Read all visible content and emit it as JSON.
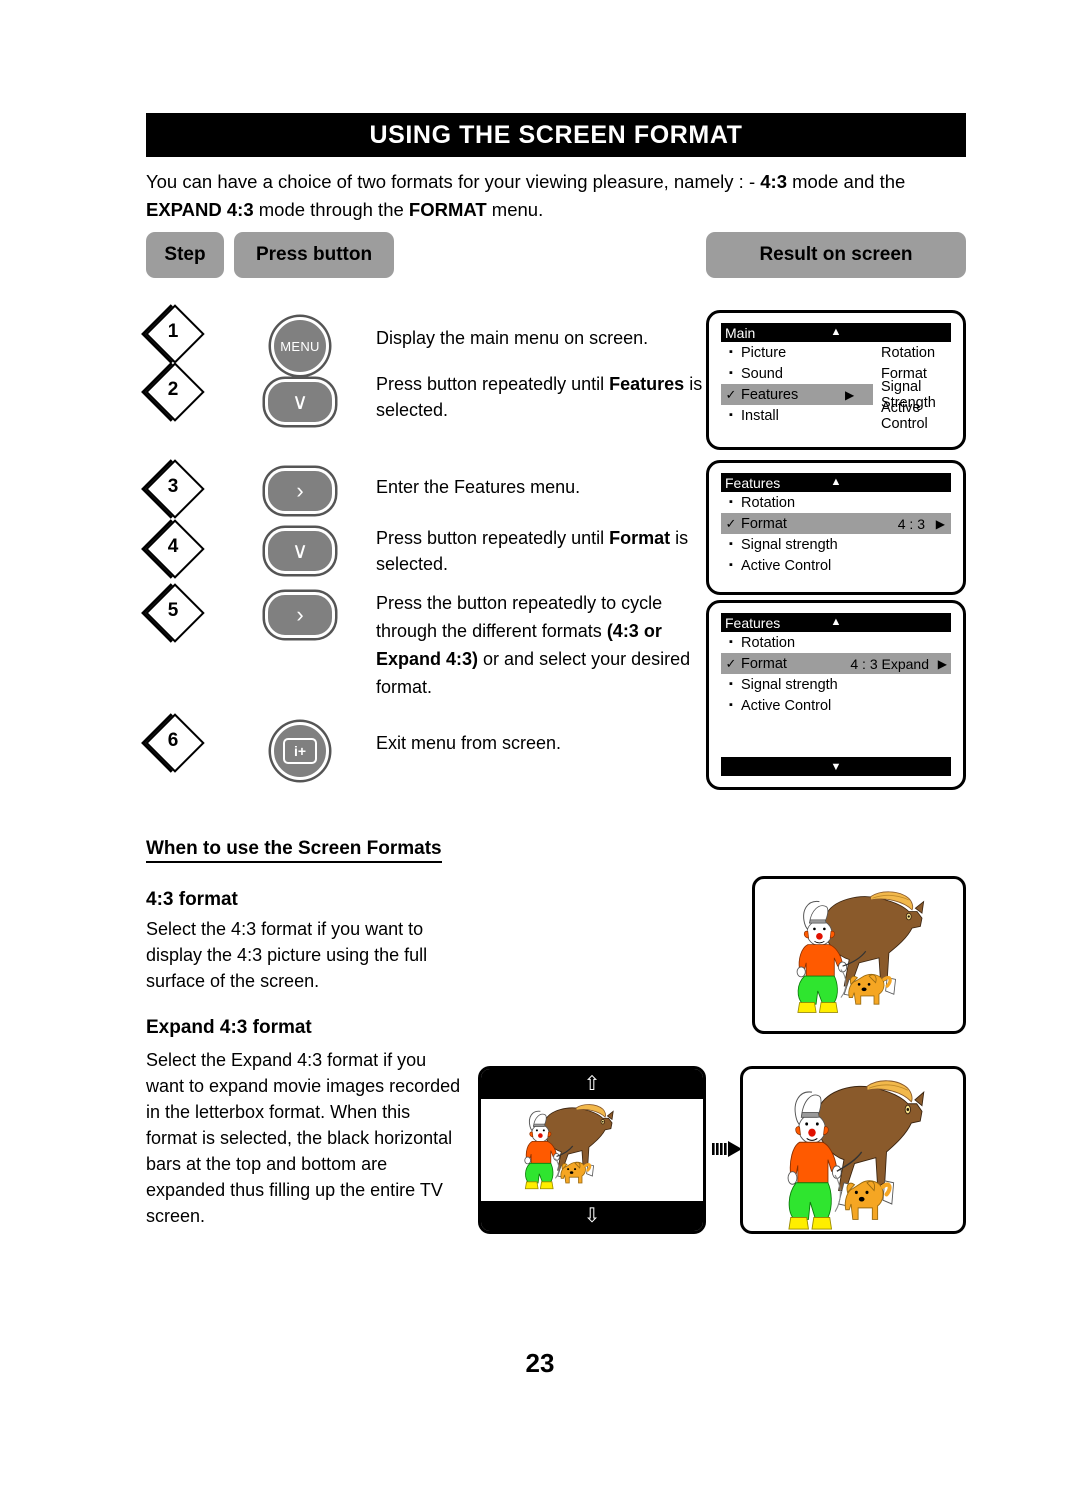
{
  "page": {
    "number": "23"
  },
  "header": {
    "title": "USING THE SCREEN FORMAT"
  },
  "intro": {
    "line1_a": "You can have a choice of two formats for your viewing pleasure, namely : - ",
    "line1_b": "4:3",
    "line1_c": " mode and the ",
    "line2_a": "EXPAND 4:3",
    "line2_b": " mode through the ",
    "line2_c": "FORMAT",
    "line2_d": " menu."
  },
  "columns": {
    "step": "Step",
    "press_button": "Press button",
    "result_on_screen": "Result on screen"
  },
  "steps": [
    {
      "number": "1",
      "button": {
        "type": "circle",
        "icon": "menu-button",
        "label": "MENU"
      },
      "text_1": "Display the main menu on screen.",
      "text_bold": "",
      "text_2": ""
    },
    {
      "number": "2",
      "button": {
        "type": "pill",
        "icon": "chevron-down-button",
        "label": "∨"
      },
      "text_1": "Press button repeatedly until ",
      "text_bold": "Features",
      "text_2": " is selected."
    },
    {
      "number": "3",
      "button": {
        "type": "pill",
        "icon": "chevron-right-button",
        "label": "›"
      },
      "text_1": "Enter the Features menu.",
      "text_bold": "",
      "text_2": ""
    },
    {
      "number": "4",
      "button": {
        "type": "pill",
        "icon": "chevron-down-button",
        "label": "∨"
      },
      "text_1": "Press button repeatedly until ",
      "text_bold": "Format",
      "text_2": " is selected."
    },
    {
      "number": "5",
      "button": {
        "type": "pill",
        "icon": "chevron-right-button",
        "label": "›"
      },
      "text_1": "Press the button repeatedly to cycle through the different formats ",
      "text_bold": "(4:3 or Expand 4:3)",
      "text_2": " or and select your desired format."
    },
    {
      "number": "6",
      "button": {
        "type": "circle",
        "icon": "info-plus-button",
        "label": "i+"
      },
      "text_1": "Exit menu from screen.",
      "text_bold": "",
      "text_2": ""
    }
  ],
  "screens": [
    {
      "name": "main-menu",
      "title": "Main",
      "up_caret": "▲",
      "rows": [
        {
          "marker": "▪",
          "label": "Picture",
          "selected": false,
          "col2": "Rotation",
          "value": "",
          "arrow": ""
        },
        {
          "marker": "▪",
          "label": "Sound",
          "selected": false,
          "col2": "Format",
          "value": "",
          "arrow": ""
        },
        {
          "marker": "✓",
          "label": "Features",
          "selected": true,
          "col2": "Signal Strength",
          "value": "",
          "arrow": "▶"
        },
        {
          "marker": "▪",
          "label": "Install",
          "selected": false,
          "col2": "Active Control",
          "value": "",
          "arrow": ""
        }
      ],
      "bottom_bar": false,
      "bottom_caret": ""
    },
    {
      "name": "features-menu-43",
      "title": "Features",
      "up_caret": "▲",
      "rows": [
        {
          "marker": "▪",
          "label": "Rotation",
          "selected": false,
          "col2": "",
          "value": "",
          "arrow": ""
        },
        {
          "marker": "✓",
          "label": "Format",
          "selected": true,
          "col2": "",
          "value": "4 : 3",
          "arrow": "▶"
        },
        {
          "marker": "▪",
          "label": "Signal strength",
          "selected": false,
          "col2": "",
          "value": "",
          "arrow": ""
        },
        {
          "marker": "▪",
          "label": "Active Control",
          "selected": false,
          "col2": "",
          "value": "",
          "arrow": ""
        }
      ],
      "bottom_bar": false,
      "bottom_caret": ""
    },
    {
      "name": "features-menu-expand",
      "title": "Features",
      "up_caret": "▲",
      "rows": [
        {
          "marker": "▪",
          "label": "Rotation",
          "selected": false,
          "col2": "",
          "value": "",
          "arrow": ""
        },
        {
          "marker": "✓",
          "label": "Format",
          "selected": true,
          "col2": "",
          "value": "4 : 3 Expand",
          "arrow": "▶"
        },
        {
          "marker": "▪",
          "label": "Signal strength",
          "selected": false,
          "col2": "",
          "value": "",
          "arrow": ""
        },
        {
          "marker": "▪",
          "label": "Active Control",
          "selected": false,
          "col2": "",
          "value": "",
          "arrow": ""
        }
      ],
      "bottom_bar": true,
      "bottom_caret": "▼"
    }
  ],
  "bottom_section": {
    "heading": "When to use the Screen Formats",
    "format_43": {
      "heading": "4:3 format",
      "body": "Select the 4:3 format if you want to display the 4:3 picture using the full surface of the screen."
    },
    "format_expand": {
      "heading": "Expand 4:3 format",
      "body": "Select the Expand 4:3 format if you want to expand movie images recorded in the letterbox format. When this format is selected, the black horizontal bars at the top and bottom are expanded thus filling up the entire TV screen."
    }
  },
  "illustrations": {
    "normal_43": {
      "name": "clown-horse-dog-picture-43"
    },
    "letterbox": {
      "name": "clown-horse-dog-picture-letterbox",
      "up_arrow": "⇧",
      "down_arrow": "⇩"
    },
    "expanded": {
      "name": "clown-horse-dog-picture-expanded"
    },
    "transition_arrow": "→"
  },
  "colors": {
    "header_bg": "#000000",
    "pill_gray": "#9d9d9d",
    "button_gray": "#808080",
    "highlight_gray": "#9d9d9d",
    "horse_brown": "#8a5a2b",
    "clown_shirt_orange": "#ff5a00",
    "clown_pants_green": "#2fe52f",
    "clown_shoes_yellow": "#ffee00",
    "dog_orange": "#f5a623"
  }
}
